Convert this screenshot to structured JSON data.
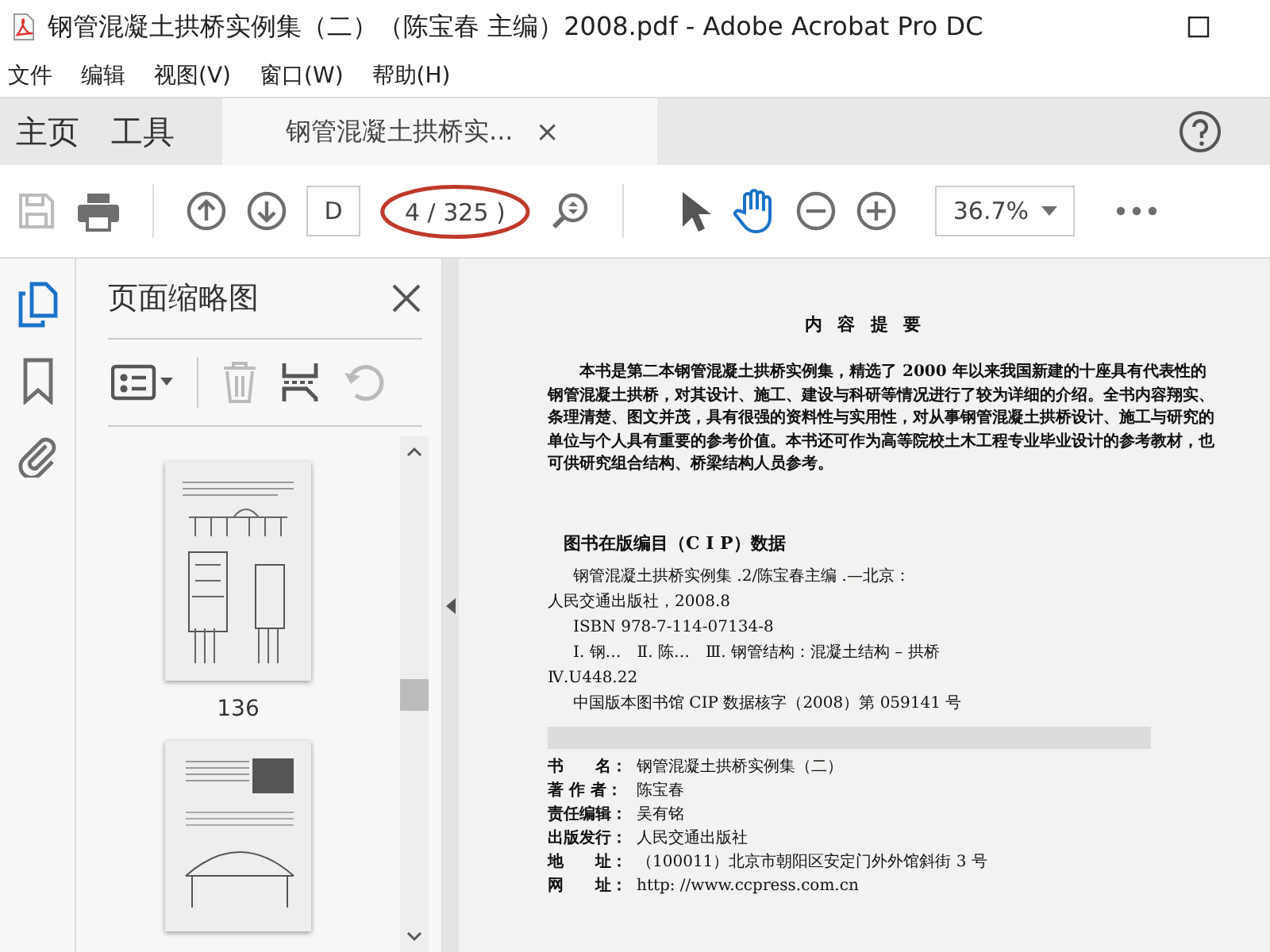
{
  "window": {
    "title": "钢管混凝土拱桥实例集（二）（陈宝春 主编）2008.pdf - Adobe Acrobat Pro DC"
  },
  "menu": [
    "文件",
    "编辑",
    "视图(V)",
    "窗口(W)",
    "帮助(H)"
  ],
  "nav_tabs": [
    {
      "label": "主页",
      "selected": false
    },
    {
      "label": "工具",
      "selected": false
    }
  ],
  "doc_tab": {
    "label": "钢管混凝土拱桥实...",
    "close": "×",
    "selected": true
  },
  "toolbar": {
    "page_field": "D",
    "page_count": "4 / 325 )",
    "zoom": "36.7%",
    "tools": [
      {
        "kind": "select",
        "selected": false
      },
      {
        "kind": "hand",
        "selected": true
      }
    ]
  },
  "sidebar": {
    "items": [
      {
        "kind": "thumbnails",
        "selected": true
      },
      {
        "kind": "bookmarks",
        "selected": false
      },
      {
        "kind": "attachments",
        "selected": false
      }
    ]
  },
  "thumbnail_panel": {
    "title": "页面缩略图",
    "thumbnails": [
      {
        "kind": "drawing",
        "label": "136"
      },
      {
        "kind": "photo"
      }
    ]
  },
  "document": {
    "heading": "内 容 提 要",
    "abstract": "本书是第二本钢管混凝土拱桥实例集，精选了 2000 年以来我国新建的十座具有代表性的钢管混凝土拱桥，对其设计、施工、建设与科研等情况进行了较为详细的介绍。全书内容翔实、条理清楚、图文并茂，具有很强的资料性与实用性，对从事钢管混凝土拱桥设计、施工与研究的单位与个人具有重要的参考价值。本书还可作为高等院校土木工程专业毕业设计的参考教材，也可供研究组合结构、桥梁结构人员参考。",
    "cip_heading": "图书在版编目（C I P）数据",
    "cip_lines": [
      {
        "text": "钢管混凝土拱桥实例集 .2/陈宝春主编 .—北京：",
        "indent": true
      },
      {
        "text": "人民交通出版社，2008.8",
        "indent": false
      },
      {
        "text": "ISBN 978-7-114-07134-8",
        "indent": true
      },
      {
        "text": "Ⅰ. 钢…　Ⅱ. 陈…　Ⅲ. 钢管结构：混凝土结构 – 拱桥",
        "indent": true
      },
      {
        "text": "Ⅳ.U448.22",
        "indent": false
      },
      {
        "text": "中国版本图书馆 CIP 数据核字（2008）第 059141 号",
        "indent": true
      }
    ],
    "colophon": [
      {
        "label": "书　　名：",
        "value": "钢管混凝土拱桥实例集（二）"
      },
      {
        "label": "著 作 者：",
        "value": "陈宝春"
      },
      {
        "label": "责任编辑：",
        "value": "吴有铭"
      },
      {
        "label": "出版发行：",
        "value": "人民交通出版社"
      },
      {
        "label": "地　　址：",
        "value": "（100011）北京市朝阳区安定门外外馆斜街 3 号"
      },
      {
        "label": "网　　址：",
        "value": "http: //www.ccpress.com.cn"
      }
    ]
  }
}
